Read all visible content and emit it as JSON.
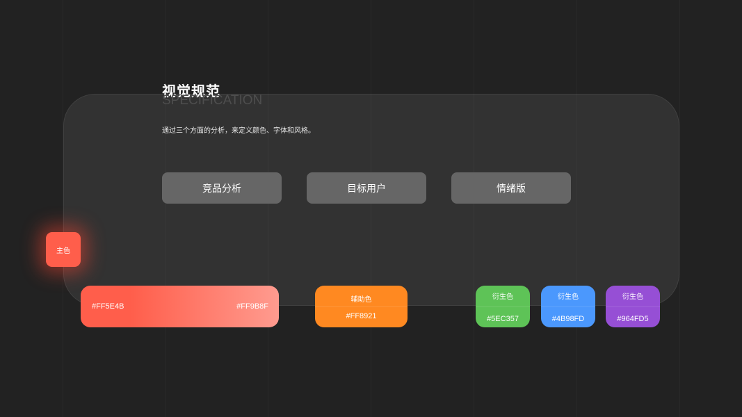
{
  "header": {
    "title": "视觉规范",
    "subtitle": "SPECIFICATION",
    "description": "通过三个方面的分析，来定义颜色、字体和风格。"
  },
  "sections": [
    {
      "label": "竞品分析"
    },
    {
      "label": "目标用户"
    },
    {
      "label": "情绪版"
    }
  ],
  "palette": {
    "primary": {
      "label": "主色",
      "hex_start": "#FF5E4B",
      "hex_end": "#FF9B8F"
    },
    "secondary": {
      "label": "辅助色",
      "hex": "#FF8921"
    },
    "derived": [
      {
        "label": "衍生色",
        "hex": "#5EC357"
      },
      {
        "label": "衍生色",
        "hex": "#4B98FD"
      },
      {
        "label": "衍生色",
        "hex": "#964FD5"
      }
    ]
  },
  "colors": {
    "background": "#222222",
    "pill": "#666666",
    "primary": "#FF5E4B",
    "primary_light": "#FF9B8F",
    "secondary": "#FF8921",
    "green": "#5EC357",
    "blue": "#4B98FD",
    "purple": "#964FD5"
  }
}
